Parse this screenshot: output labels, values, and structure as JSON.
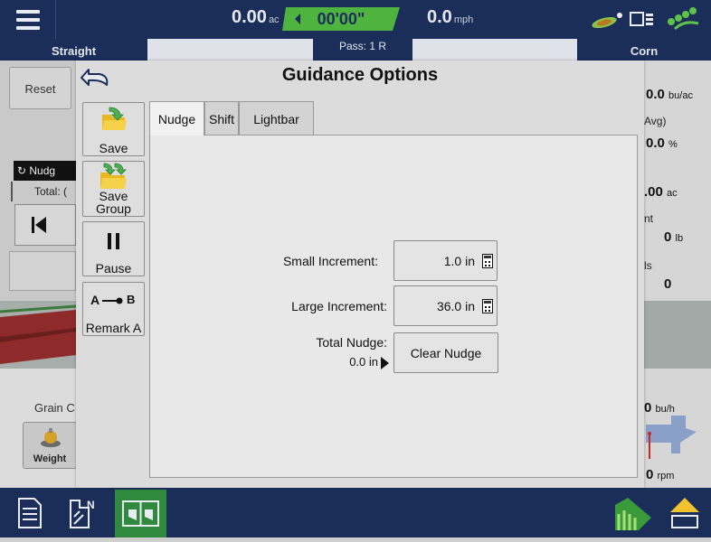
{
  "topbar": {
    "area_value": "0.00",
    "area_unit": "ac",
    "timer": "00'00\"",
    "speed_value": "0.0",
    "speed_unit": "mph"
  },
  "header": {
    "guidance_mode": "Straight",
    "pass_label": "Pass: 1 R",
    "crop": "Corn"
  },
  "background_left": {
    "reset_label": "Reset",
    "nudge_chip": "Nudg",
    "total_chip": "Total: (",
    "grain_label": "Grain C",
    "weight_label": "Weight"
  },
  "background_right": {
    "yield_value": "0.0",
    "yield_unit": "bu/ac",
    "avg_label": "Avg)",
    "moisture_value": "0.0",
    "moisture_unit": "%",
    "area_value": ".00",
    "area_unit": "ac",
    "t_label": "nt",
    "weight_value": "0",
    "weight_unit": "lb",
    "ls_label": "ls",
    "count_value": "0",
    "flow_value": "0",
    "flow_unit": "bu/h",
    "rpm_value": "0",
    "rpm_unit": "rpm"
  },
  "dialog": {
    "title": "Guidance Options",
    "side_buttons": {
      "save": "Save",
      "save_group_line1": "Save",
      "save_group_line2": "Group",
      "pause": "Pause",
      "remark_a": "Remark A",
      "remark_icon_a": "A",
      "remark_icon_b": "B"
    },
    "tabs": [
      "Nudge",
      "Shift",
      "Lightbar"
    ],
    "active_tab": "Nudge",
    "nudge": {
      "small_increment_label": "Small Increment:",
      "small_increment_value": "1.0 in",
      "large_increment_label": "Large Increment:",
      "large_increment_value": "36.0 in",
      "total_nudge_label": "Total Nudge:",
      "total_nudge_value": "0.0 in",
      "clear_button": "Clear Nudge"
    }
  },
  "colors": {
    "navy": "#1b2e5a",
    "accent_green": "#2f8a3e",
    "timer_green": "#4fb33f"
  }
}
